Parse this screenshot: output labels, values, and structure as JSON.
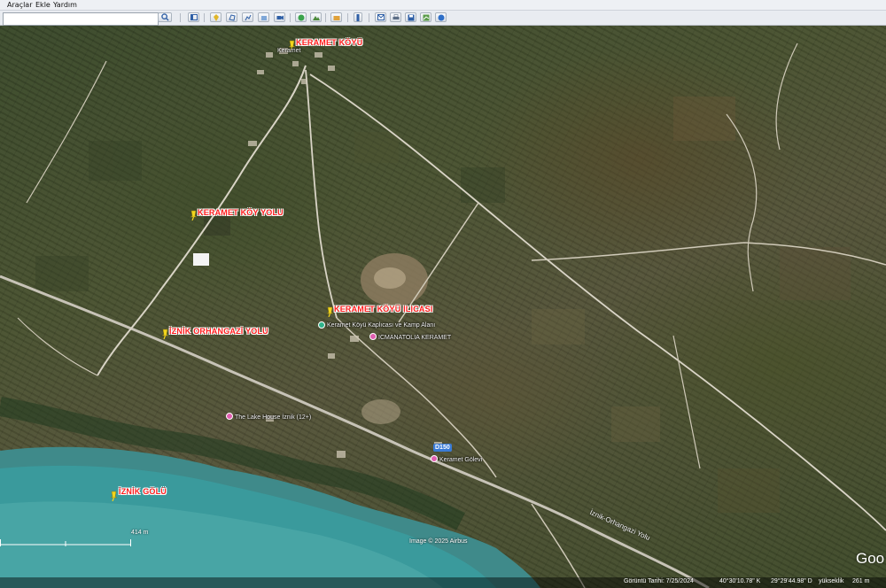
{
  "menu": {
    "tools": "Araçlar",
    "add": "Ekle",
    "help": "Yardım"
  },
  "toolbar": {
    "search_value": "",
    "icons": [
      "sidebar-toggle-icon",
      "add-placemark-icon",
      "add-polygon-icon",
      "add-path-icon",
      "add-image-overlay-icon",
      "record-tour-icon",
      "historical-imagery-icon",
      "sunlight-icon",
      "planets-icon",
      "ruler-icon",
      "email-icon",
      "print-icon",
      "save-image-icon",
      "view-in-maps-icon",
      "earth-icon"
    ]
  },
  "map": {
    "pins": [
      {
        "label": "KERAMET KÖYÜ"
      },
      {
        "label": "KERAMET KÖY YOLU"
      },
      {
        "label": "KERAMET KÖYÜ ILICASI"
      },
      {
        "label": "İZNİK ORHANGAZİ YOLU"
      },
      {
        "label": "İZNİK GÖLÜ"
      }
    ],
    "places": {
      "village": "Keramet",
      "camp": "Keramet Köyü Kaplıcası ve Kamp Alanı",
      "hotel_anatolia": "ICMANATOLIA KERAMET",
      "lake_house": "The Lake House İznik (12+)",
      "golevi": "Keramet Gölevi",
      "route": "D150",
      "road": "İznik-Orhangazi Yolu"
    },
    "colors": {
      "pin": "#f2d51c",
      "pin_label": "#ff1c1c",
      "poi": "#e05fb0",
      "poi_camp": "#2fb38a",
      "lake": "#3a8a8c"
    },
    "copyright": "Image © 2025 Airbus",
    "scale": "414 m",
    "brand": "Goo"
  },
  "status": {
    "date": "Görüntü Tarihi: 7/25/2024",
    "lat": "40°30'10.78\" K",
    "lon": "29°29'44.98\" D",
    "elev_label": "yükseklik",
    "elev": "261 m"
  }
}
